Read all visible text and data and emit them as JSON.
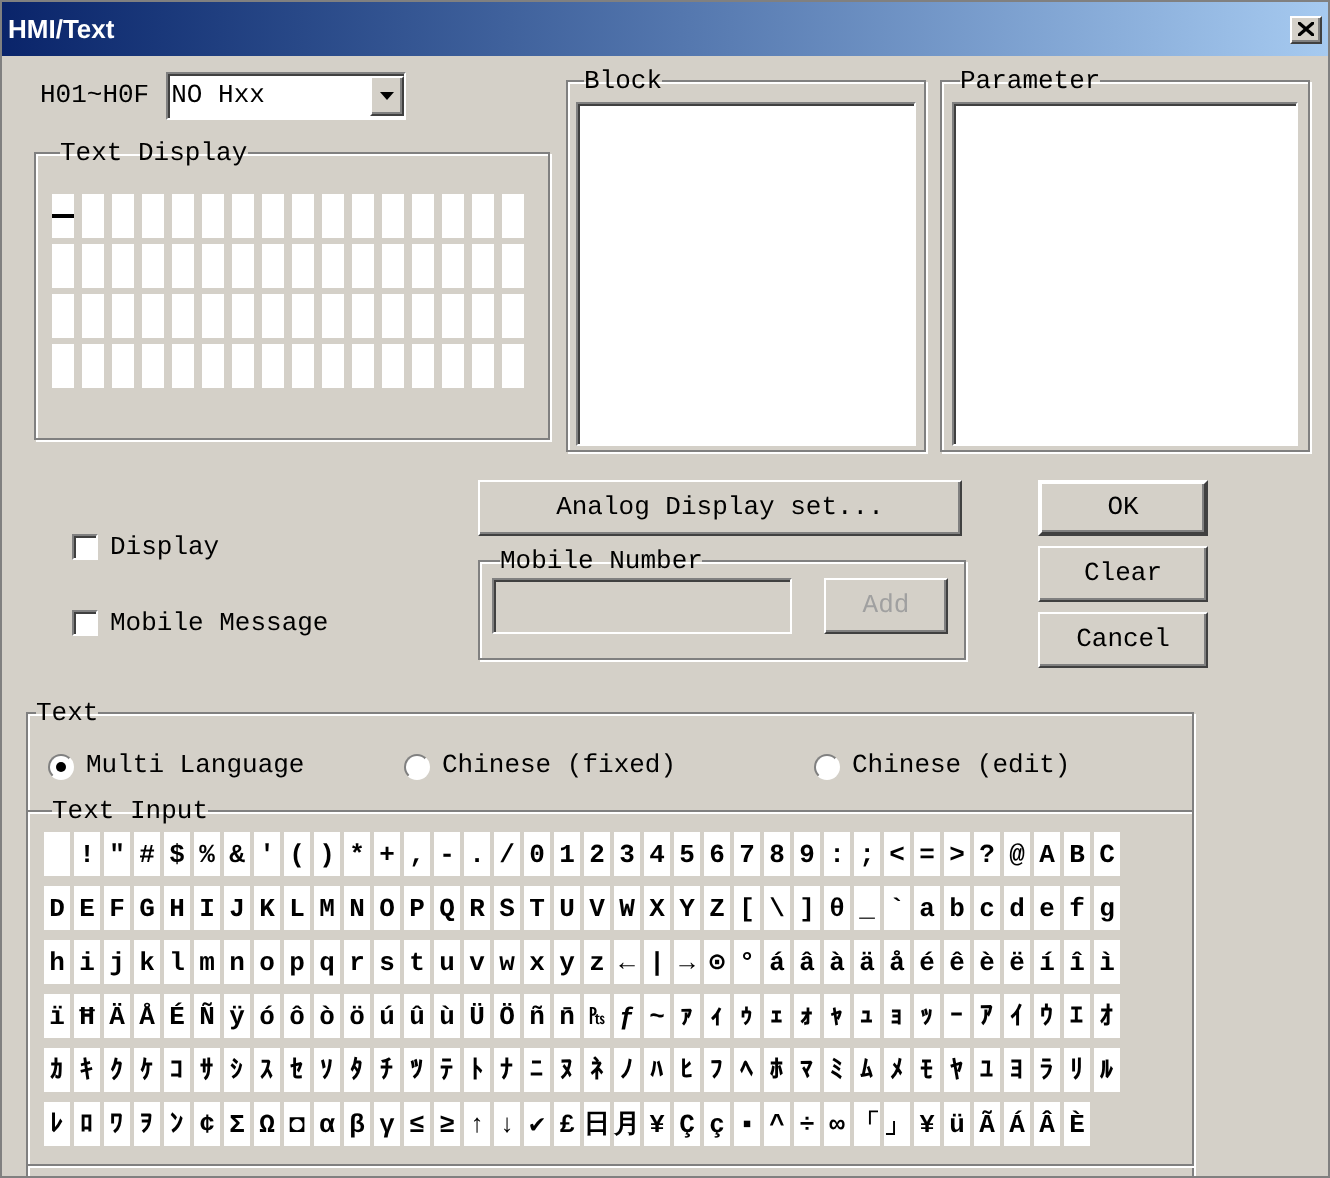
{
  "window": {
    "title": "HMI/Text"
  },
  "register": {
    "label": "H01~H0F",
    "value": "NO Hxx"
  },
  "text_display": {
    "title": "Text Display",
    "rows": [
      {
        "cursor": [
          true,
          false,
          false,
          false,
          false,
          false,
          false,
          false,
          false,
          false,
          false,
          false,
          false,
          false,
          false,
          false
        ]
      },
      {
        "cursor": [
          false,
          false,
          false,
          false,
          false,
          false,
          false,
          false,
          false,
          false,
          false,
          false,
          false,
          false,
          false,
          false
        ]
      },
      {
        "cursor": [
          false,
          false,
          false,
          false,
          false,
          false,
          false,
          false,
          false,
          false,
          false,
          false,
          false,
          false,
          false,
          false
        ]
      },
      {
        "cursor": [
          false,
          false,
          false,
          false,
          false,
          false,
          false,
          false,
          false,
          false,
          false,
          false,
          false,
          false,
          false,
          false
        ]
      }
    ]
  },
  "block": {
    "title": "Block"
  },
  "parameter": {
    "title": "Parameter"
  },
  "options": [
    {
      "label": "Display",
      "checked": false
    },
    {
      "label": "Mobile Message",
      "checked": false
    }
  ],
  "analog_button": "Analog Display set...",
  "mobile_number": {
    "title": "Mobile Number",
    "disabled": true,
    "add_button": {
      "label": "Add",
      "disabled": true
    }
  },
  "buttons": [
    {
      "label": "OK",
      "default": true
    },
    {
      "label": "Clear",
      "default": false
    },
    {
      "label": "Cancel",
      "default": false
    }
  ],
  "text": {
    "title": "Text",
    "languages": [
      {
        "label": "Multi Language",
        "selected": true
      },
      {
        "label": "Chinese (fixed)",
        "selected": false
      },
      {
        "label": "Chinese (edit)",
        "selected": false
      }
    ]
  },
  "text_input": {
    "title": "Text Input",
    "rows": [
      [
        " ",
        "!",
        "″",
        "#",
        "$",
        "%",
        "&",
        "'",
        "(",
        ")",
        "*",
        "+",
        ",",
        "-",
        ".",
        "/",
        "0",
        "1",
        "2",
        "3",
        "4",
        "5",
        "6",
        "7",
        "8",
        "9",
        ":",
        ";",
        "<",
        "=",
        ">",
        "?",
        "@",
        "A",
        "B",
        "C"
      ],
      [
        "D",
        "E",
        "F",
        "G",
        "H",
        "I",
        "J",
        "K",
        "L",
        "M",
        "N",
        "O",
        "P",
        "Q",
        "R",
        "S",
        "T",
        "U",
        "V",
        "W",
        "X",
        "Y",
        "Z",
        "[",
        "\\",
        "]",
        "θ",
        "_",
        "`",
        "a",
        "b",
        "c",
        "d",
        "e",
        "f",
        "g"
      ],
      [
        "h",
        "i",
        "j",
        "k",
        "l",
        "m",
        "n",
        "o",
        "p",
        "q",
        "r",
        "s",
        "t",
        "u",
        "v",
        "w",
        "x",
        "y",
        "z",
        "←",
        "|",
        "→",
        "⊙",
        "°",
        "á",
        "â",
        "à",
        "ä",
        "å",
        "é",
        "ê",
        "è",
        "ë",
        "í",
        "î",
        "ì"
      ],
      [
        "ï",
        "Ħ",
        "Ä",
        "Å",
        "É",
        "Ñ",
        "ÿ",
        "ó",
        "ô",
        "ò",
        "ö",
        "ú",
        "û",
        "ù",
        "Ü",
        "Ö",
        "ñ",
        "n̄",
        "₧",
        "ƒ",
        "~",
        "ｧ",
        "ｨ",
        "ｩ",
        "ｪ",
        "ｫ",
        "ｬ",
        "ｭ",
        "ｮ",
        "ｯ",
        "ｰ",
        "ｱ",
        "ｲ",
        "ｳ",
        "ｴ",
        "ｵ"
      ],
      [
        "ｶ",
        "ｷ",
        "ｸ",
        "ｹ",
        "ｺ",
        "ｻ",
        "ｼ",
        "ｽ",
        "ｾ",
        "ｿ",
        "ﾀ",
        "ﾁ",
        "ﾂ",
        "ﾃ",
        "ﾄ",
        "ﾅ",
        "ﾆ",
        "ﾇ",
        "ﾈ",
        "ﾉ",
        "ﾊ",
        "ﾋ",
        "ﾌ",
        "ﾍ",
        "ﾎ",
        "ﾏ",
        "ﾐ",
        "ﾑ",
        "ﾒ",
        "ﾓ",
        "ﾔ",
        "ﾕ",
        "ﾖ",
        "ﾗ",
        "ﾘ",
        "ﾙ"
      ],
      [
        "ﾚ",
        "ﾛ",
        "ﾜ",
        "ｦ",
        "ﾝ",
        "¢",
        "Σ",
        "Ω",
        "◘",
        "α",
        "β",
        "γ",
        "≤",
        "≥",
        "↑",
        "↓",
        "✔",
        "£",
        "日",
        "月",
        "¥",
        "Ç",
        "ç",
        "▪",
        "^",
        "÷",
        "∞",
        "「",
        "」",
        "¥",
        "ü",
        "Ã",
        "Á",
        "Â",
        "È"
      ]
    ]
  }
}
